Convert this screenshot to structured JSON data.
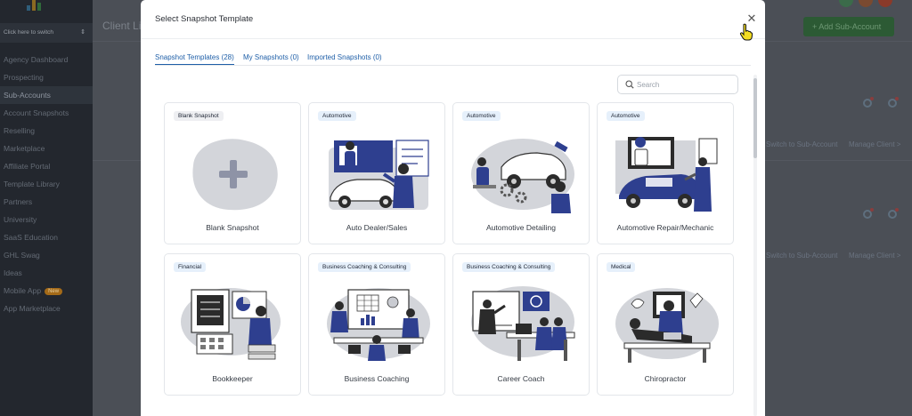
{
  "sidebar": {
    "switch_label": "Click here to switch",
    "items": [
      {
        "label": "Agency Dashboard"
      },
      {
        "label": "Prospecting"
      },
      {
        "label": "Sub-Accounts"
      },
      {
        "label": "Account Snapshots"
      },
      {
        "label": "Reselling"
      },
      {
        "label": "Marketplace"
      },
      {
        "label": "Affiliate Portal"
      },
      {
        "label": "Template Library"
      },
      {
        "label": "Partners"
      },
      {
        "label": "University"
      },
      {
        "label": "SaaS Education"
      },
      {
        "label": "GHL Swag"
      },
      {
        "label": "Ideas"
      },
      {
        "label": "Mobile App",
        "badge": "New"
      },
      {
        "label": "App Marketplace"
      }
    ]
  },
  "background": {
    "page_title": "Client List",
    "add_button": "+ Add Sub-Account",
    "switch_link": "Switch to Sub-Account",
    "manage_link": "Manage Client >"
  },
  "modal": {
    "title": "Select Snapshot Template",
    "close_icon": "close-icon",
    "tabs": [
      {
        "label": "Snapshot Templates (28)",
        "active": true
      },
      {
        "label": "My Snapshots (0)",
        "active": false
      },
      {
        "label": "Imported Snapshots (0)",
        "active": false
      }
    ],
    "search": {
      "placeholder": "Search",
      "value": ""
    },
    "cards": [
      {
        "category": "Blank Snapshot",
        "name": "Blank Snapshot"
      },
      {
        "category": "Automotive",
        "name": "Auto Dealer/Sales"
      },
      {
        "category": "Automotive",
        "name": "Automotive Detailing"
      },
      {
        "category": "Automotive",
        "name": "Automotive Repair/Mechanic"
      },
      {
        "category": "Financial",
        "name": "Bookkeeper"
      },
      {
        "category": "Business Coaching & Consulting",
        "name": "Business Coaching"
      },
      {
        "category": "Business Coaching & Consulting",
        "name": "Career Coach"
      },
      {
        "category": "Medical",
        "name": "Chiropractor"
      }
    ]
  },
  "colors": {
    "accent": "#1f5fa8",
    "chip_bg": "#e6f0fb",
    "illustration_navy": "#2e3f8f",
    "illustration_gray": "#c9cbd1"
  }
}
